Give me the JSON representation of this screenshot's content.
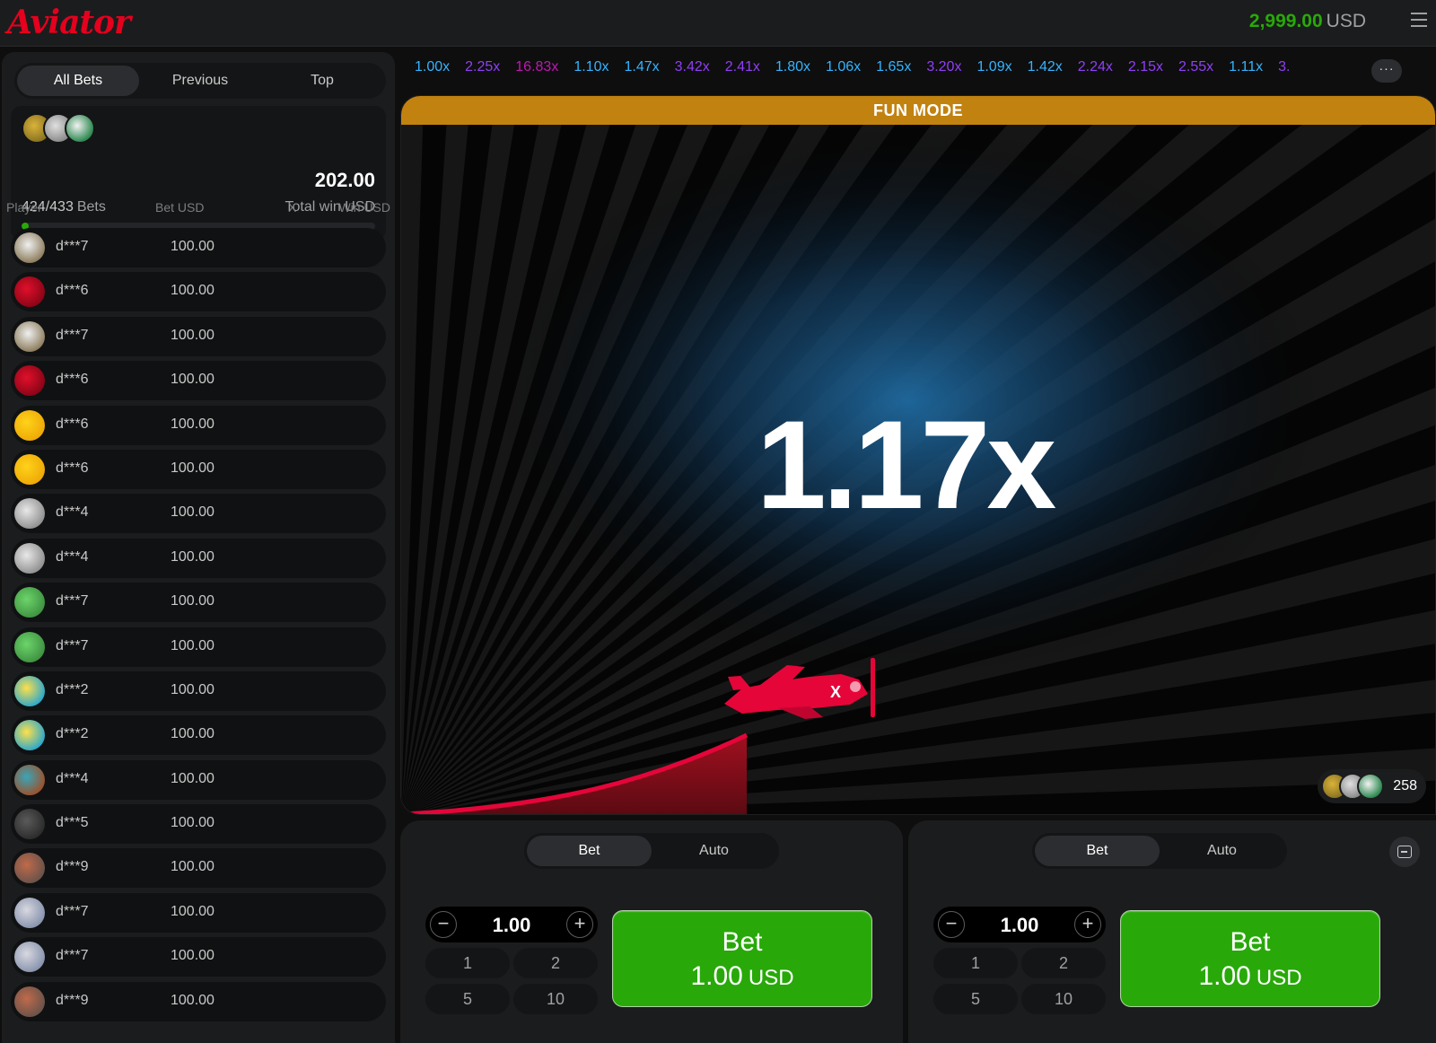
{
  "app": {
    "logo": "Aviator",
    "balance_amount": "2,999.00",
    "balance_currency": "USD"
  },
  "bets_panel": {
    "tabs": [
      "All Bets",
      "Previous",
      "Top"
    ],
    "active_tab": "All Bets",
    "bets_count": "424/433",
    "bets_label": "Bets",
    "total_win": "202.00",
    "total_win_label": "Total win USD",
    "progress_fraction": 0.02,
    "columns": {
      "player": "Player",
      "bet": "Bet USD",
      "x": "X",
      "win": "Win USD"
    },
    "rows": [
      {
        "name": "d***7",
        "bet": "100.00",
        "avatar": "eagle-avatar"
      },
      {
        "name": "d***6",
        "bet": "100.00",
        "avatar": "red-dice-avatar"
      },
      {
        "name": "d***7",
        "bet": "100.00",
        "avatar": "eagle-avatar"
      },
      {
        "name": "d***6",
        "bet": "100.00",
        "avatar": "red-dice-avatar"
      },
      {
        "name": "d***6",
        "bet": "100.00",
        "avatar": "chick-avatar"
      },
      {
        "name": "d***6",
        "bet": "100.00",
        "avatar": "chick-avatar"
      },
      {
        "name": "d***4",
        "bet": "100.00",
        "avatar": "bird-avatar"
      },
      {
        "name": "d***4",
        "bet": "100.00",
        "avatar": "bird-avatar"
      },
      {
        "name": "d***7",
        "bet": "100.00",
        "avatar": "clover-avatar"
      },
      {
        "name": "d***7",
        "bet": "100.00",
        "avatar": "clover-avatar"
      },
      {
        "name": "d***2",
        "bet": "100.00",
        "avatar": "letter-a-avatar"
      },
      {
        "name": "d***2",
        "bet": "100.00",
        "avatar": "letter-a-avatar"
      },
      {
        "name": "d***4",
        "bet": "100.00",
        "avatar": "face-avatar"
      },
      {
        "name": "d***5",
        "bet": "100.00",
        "avatar": "glasses-avatar"
      },
      {
        "name": "d***9",
        "bet": "100.00",
        "avatar": "rock-avatar"
      },
      {
        "name": "d***7",
        "bet": "100.00",
        "avatar": "money-avatar"
      },
      {
        "name": "d***7",
        "bet": "100.00",
        "avatar": "money-avatar"
      },
      {
        "name": "d***9",
        "bet": "100.00",
        "avatar": "rock-avatar"
      }
    ]
  },
  "history": [
    {
      "v": "1.00x",
      "color": "#34b4ff"
    },
    {
      "v": "2.25x",
      "color": "#913ef8"
    },
    {
      "v": "16.83x",
      "color": "#c017b4"
    },
    {
      "v": "1.10x",
      "color": "#34b4ff"
    },
    {
      "v": "1.47x",
      "color": "#34b4ff"
    },
    {
      "v": "3.42x",
      "color": "#913ef8"
    },
    {
      "v": "2.41x",
      "color": "#913ef8"
    },
    {
      "v": "1.80x",
      "color": "#34b4ff"
    },
    {
      "v": "1.06x",
      "color": "#34b4ff"
    },
    {
      "v": "1.65x",
      "color": "#34b4ff"
    },
    {
      "v": "3.20x",
      "color": "#913ef8"
    },
    {
      "v": "1.09x",
      "color": "#34b4ff"
    },
    {
      "v": "1.42x",
      "color": "#34b4ff"
    },
    {
      "v": "2.24x",
      "color": "#913ef8"
    },
    {
      "v": "2.15x",
      "color": "#913ef8"
    },
    {
      "v": "2.55x",
      "color": "#913ef8"
    },
    {
      "v": "1.11x",
      "color": "#34b4ff"
    },
    {
      "v": "3.",
      "color": "#913ef8"
    }
  ],
  "history_more": "···",
  "game": {
    "banner": "FUN MODE",
    "multiplier": "1.17x",
    "players_online": "258"
  },
  "bet_panels": [
    {
      "tabs": [
        "Bet",
        "Auto"
      ],
      "active_tab": "Bet",
      "stake": "1.00",
      "quick": [
        "1",
        "2",
        "5",
        "10"
      ],
      "button_label": "Bet",
      "button_amount": "1.00",
      "button_currency": "USD"
    },
    {
      "tabs": [
        "Bet",
        "Auto"
      ],
      "active_tab": "Bet",
      "stake": "1.00",
      "quick": [
        "1",
        "2",
        "5",
        "10"
      ],
      "button_label": "Bet",
      "button_amount": "1.00",
      "button_currency": "USD"
    }
  ],
  "colors": {
    "accent_green": "#28a909",
    "brand_red": "#e5001e",
    "fun_mode": "#c28210"
  }
}
